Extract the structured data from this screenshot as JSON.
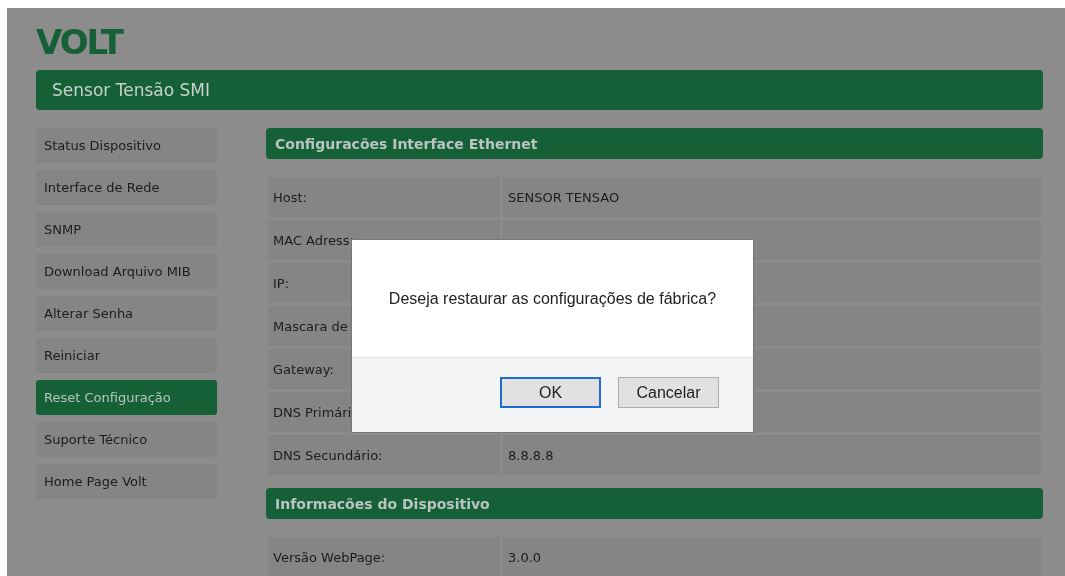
{
  "logo": "VOLT",
  "header": {
    "title": "Sensor Tensão SMI"
  },
  "sidebar": {
    "items": [
      {
        "label": "Status Dispositivo",
        "selected": false
      },
      {
        "label": "Interface de Rede",
        "selected": false
      },
      {
        "label": "SNMP",
        "selected": false
      },
      {
        "label": "Download Arquivo MIB",
        "selected": false
      },
      {
        "label": "Alterar Senha",
        "selected": false
      },
      {
        "label": "Reiniciar",
        "selected": false
      },
      {
        "label": "Reset Configuração",
        "selected": true
      },
      {
        "label": "Suporte Técnico",
        "selected": false
      },
      {
        "label": "Home Page Volt",
        "selected": false
      }
    ]
  },
  "sections": [
    {
      "title": "Configuracões Interface Ethernet",
      "rows": [
        {
          "label": "Host:",
          "value": "SENSOR TENSAO"
        },
        {
          "label": "MAC Adress:"
        },
        {
          "label": "IP:"
        },
        {
          "label": "Mascara de"
        },
        {
          "label": "Gateway:"
        },
        {
          "label": "DNS Primári"
        },
        {
          "label": "DNS Secundário:",
          "value": "8.8.8.8"
        }
      ]
    },
    {
      "title": "Informacões do Dispositivo",
      "rows": [
        {
          "label": "Versão WebPage:",
          "value": "3.0.0"
        }
      ]
    }
  ],
  "dialog": {
    "message": "Deseja restaurar as configurações de fábrica?",
    "buttons": [
      {
        "label": "OK",
        "focused": true
      },
      {
        "label": "Cancelar",
        "focused": false
      }
    ]
  }
}
